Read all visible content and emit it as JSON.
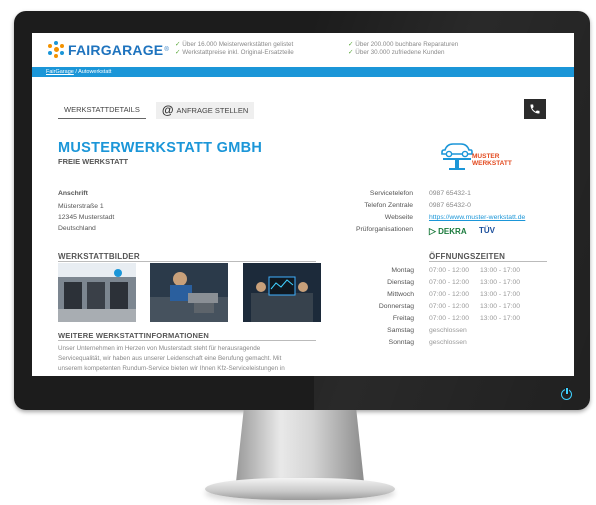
{
  "header": {
    "logo": "FAIRGARAGE",
    "logo_trademark": "®",
    "claims_left": [
      "Über 16.000 Meisterwerkstätten gelistet",
      "Werkstattpreise inkl. Original-Ersatzteile"
    ],
    "claims_right": [
      "Über 200.000 buchbare Reparaturen",
      "Über 30.000 zufriedene Kunden"
    ],
    "breadcrumb_home": "FairGarage",
    "breadcrumb_sep": "/",
    "breadcrumb_current": "Autowerkstatt"
  },
  "tabs": [
    "WERKSTATTDETAILS",
    "ANFRAGE STELLEN"
  ],
  "tab_at": "@",
  "company": {
    "name": "MUSTERWERKSTATT GMBH",
    "type": "FREIE WERKSTATT"
  },
  "brand_logo": {
    "line1": "MUSTER",
    "line2": "WERKSTATT"
  },
  "address": {
    "label": "Anschrift",
    "street": "Müsterstraße 1",
    "city": "12345 Musterstadt",
    "country": "Deutschland"
  },
  "contact": [
    {
      "label": "Servicetelefon",
      "value": "0987 65432-1",
      "link": false
    },
    {
      "label": "Telefon Zentrale",
      "value": "0987 65432-0",
      "link": false
    },
    {
      "label": "Webseite",
      "value": "https://www.muster-werkstatt.de",
      "link": true
    },
    {
      "label": "Prüforganisationen",
      "value": "",
      "link": false
    }
  ],
  "pruef": {
    "dekra": "DEKRA",
    "tuv": "TÜV"
  },
  "sections": {
    "pictures": "WERKSTATTBILDER",
    "hours": "ÖFFNUNGSZEITEN",
    "more_info": "WEITERE WERKSTATTINFORMATIONEN"
  },
  "hours": [
    {
      "day": "Montag",
      "t1": "07:00 - 12:00",
      "t2": "13:00 - 17:00"
    },
    {
      "day": "Dienstag",
      "t1": "07:00 - 12:00",
      "t2": "13:00 - 17:00"
    },
    {
      "day": "Mittwoch",
      "t1": "07:00 - 12:00",
      "t2": "13:00 - 17:00"
    },
    {
      "day": "Donnerstag",
      "t1": "07:00 - 12:00",
      "t2": "13:00 - 17:00"
    },
    {
      "day": "Freitag",
      "t1": "07:00 - 12:00",
      "t2": "13:00 - 17:00"
    },
    {
      "day": "Samstag",
      "t1": "geschlossen",
      "t2": ""
    },
    {
      "day": "Sonntag",
      "t1": "geschlossen",
      "t2": ""
    }
  ],
  "info_text": [
    "Unser Unternehmen im Herzen von Musterstadt steht für herausragende",
    "Servicequalität, wir haben aus unserer Leidenschaft eine Berufung gemacht. Mit",
    "unserem kompetenten Rundum-Service bieten wir Ihnen Kfz-Serviceleistungen in"
  ],
  "colors": {
    "brand_blue": "#1b96d8",
    "brand_orange": "#f39200",
    "monitor": "#1c1c1c",
    "power_led": "#3fd0ff"
  }
}
